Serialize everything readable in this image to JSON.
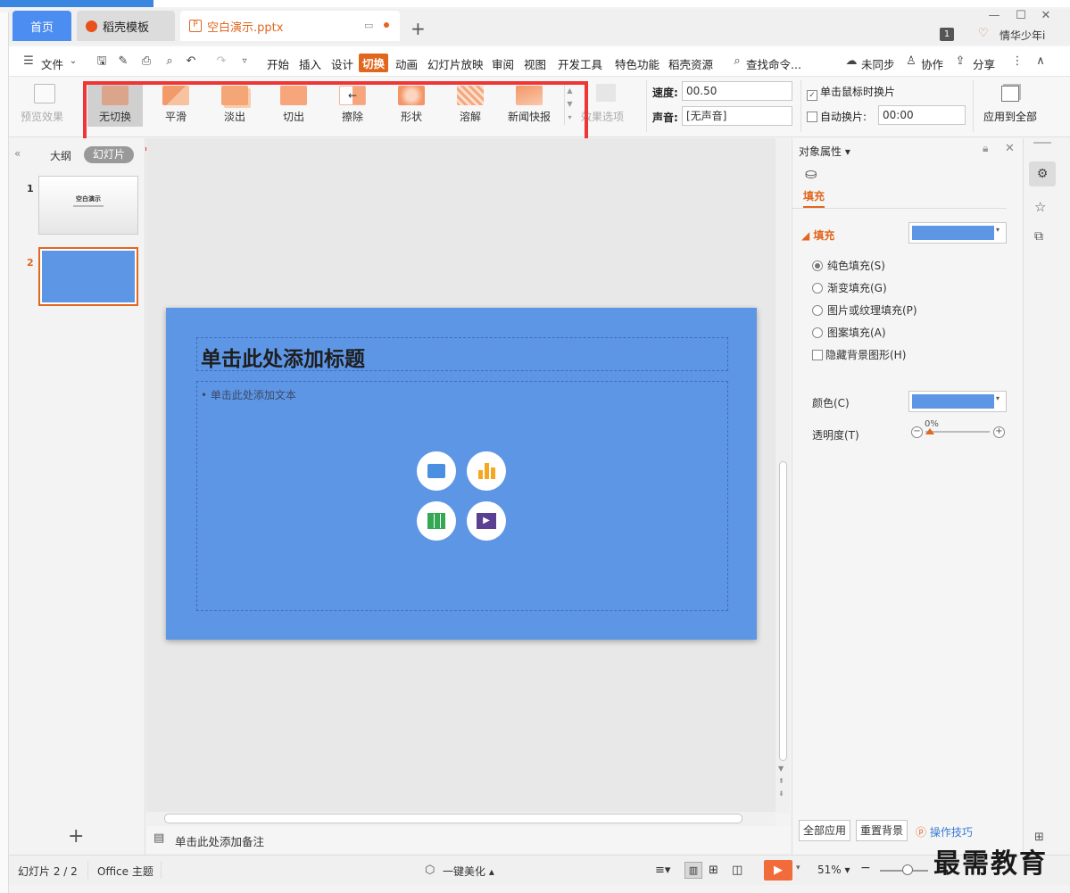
{
  "tabs": {
    "home": "首页",
    "template": "稻壳模板",
    "document": "空白演示.pptx"
  },
  "window": {
    "account_badge": "1",
    "user_name": "情华少年i"
  },
  "menu": {
    "file": "文件",
    "items": [
      "开始",
      "插入",
      "设计",
      "切换",
      "动画",
      "幻灯片放映",
      "审阅",
      "视图",
      "开发工具",
      "特色功能",
      "稻壳资源"
    ],
    "active": "切换",
    "search": "查找命令...",
    "sync": "未同步",
    "collab": "协作",
    "share": "分享"
  },
  "ribbon": {
    "preview": "预览效果",
    "transitions": [
      {
        "label": "无切换",
        "selected": true
      },
      {
        "label": "平滑",
        "selected": false
      },
      {
        "label": "淡出",
        "selected": false
      },
      {
        "label": "切出",
        "selected": false
      },
      {
        "label": "擦除",
        "selected": false
      },
      {
        "label": "形状",
        "selected": false
      },
      {
        "label": "溶解",
        "selected": false
      },
      {
        "label": "新闻快报",
        "selected": false
      }
    ],
    "effect_options": "效果选项",
    "speed_label": "速度:",
    "speed_value": "00.50",
    "sound_label": "声音:",
    "sound_value": "[无声音]",
    "click_to_switch": "单击鼠标时换片",
    "auto_switch": "自动换片:",
    "auto_time": "00:00",
    "apply_all": "应用到全部"
  },
  "left_pane": {
    "outline": "大纲",
    "slides": "幻灯片",
    "thumb1_title": "空白演示",
    "slide_numbers": [
      "1",
      "2"
    ]
  },
  "slide": {
    "title_placeholder": "单击此处添加标题",
    "text_placeholder": "单击此处添加文本"
  },
  "notes": "单击此处添加备注",
  "right_pane": {
    "title": "对象属性",
    "tab_fill": "填充",
    "section_fill": "填充",
    "options": [
      "纯色填充(S)",
      "渐变填充(G)",
      "图片或纹理填充(P)",
      "图案填充(A)"
    ],
    "hide_bg": "隐藏背景图形(H)",
    "color_label": "颜色(C)",
    "transparency_label": "透明度(T)",
    "transparency_value": "0%",
    "apply_all": "全部应用",
    "reset_bg": "重置背景",
    "tips": "操作技巧"
  },
  "status": {
    "slide_count": "幻灯片 2 / 2",
    "theme": "Office 主题",
    "beautify": "一键美化",
    "zoom": "51%"
  },
  "watermark": "最需教育",
  "colors": {
    "accent": "#e2671e",
    "home_tab": "#4b8df0",
    "slide_bg": "#5e96e6",
    "highlight": "#ef3535"
  }
}
